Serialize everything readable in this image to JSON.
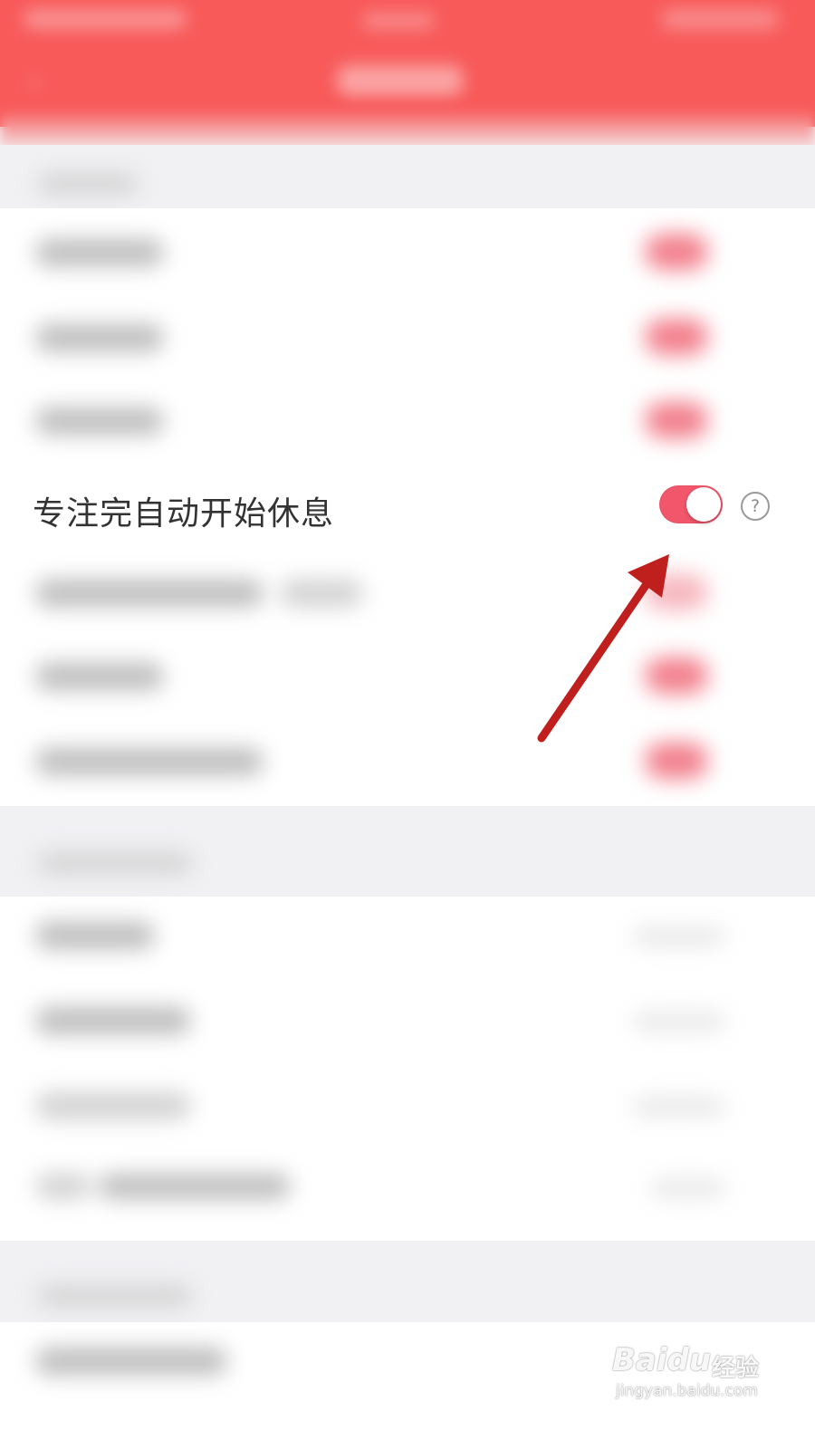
{
  "header": {
    "back_icon": "back-arrow-icon"
  },
  "focused_setting": {
    "label": "专注完自动开始休息",
    "toggle_state": "on",
    "help_icon_glyph": "?"
  },
  "colors": {
    "header_red": "#f85a5a",
    "toggle_on": "#f2566a",
    "annotation_arrow": "#c0201d"
  },
  "watermark": {
    "brand": "Baidu",
    "brand_cn": "经验",
    "url": "jingyan.baidu.com"
  }
}
